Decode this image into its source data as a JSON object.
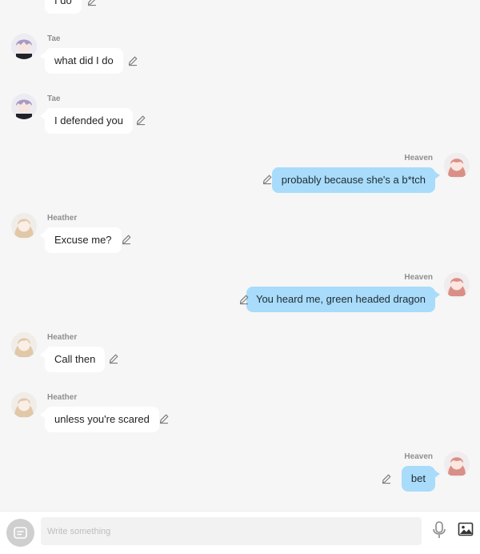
{
  "messages": [
    {
      "side": "left",
      "sender": "",
      "text": "I do",
      "avatar": "tae-avatar"
    },
    {
      "side": "left",
      "sender": "Tae",
      "text": "what did I do",
      "avatar": "tae-avatar"
    },
    {
      "side": "left",
      "sender": "Tae",
      "text": "I defended you",
      "avatar": "tae-avatar"
    },
    {
      "side": "right",
      "sender": "Heaven",
      "text": "probably because she's a b*tch",
      "avatar": "heaven-avatar"
    },
    {
      "side": "left",
      "sender": "Heather",
      "text": "Excuse me?",
      "avatar": "heather-avatar"
    },
    {
      "side": "right",
      "sender": "Heaven",
      "text": "You heard me, green headed dragon",
      "avatar": "heaven-avatar"
    },
    {
      "side": "left",
      "sender": "Heather",
      "text": "Call then",
      "avatar": "heather-avatar"
    },
    {
      "side": "left",
      "sender": "Heather",
      "text": "unless you're scared",
      "avatar": "heather-avatar"
    },
    {
      "side": "right",
      "sender": "Heaven",
      "text": "bet",
      "avatar": "heaven-avatar"
    }
  ],
  "composer": {
    "placeholder": "Write something",
    "sticker_icon": "sticker-icon",
    "mic_icon": "microphone-icon",
    "image_icon": "image-icon"
  },
  "colors": {
    "background": "#f6f6f6",
    "left_bubble": "#ffffff",
    "right_bubble": "#a8dcfa",
    "name": "#8f8f8f"
  }
}
